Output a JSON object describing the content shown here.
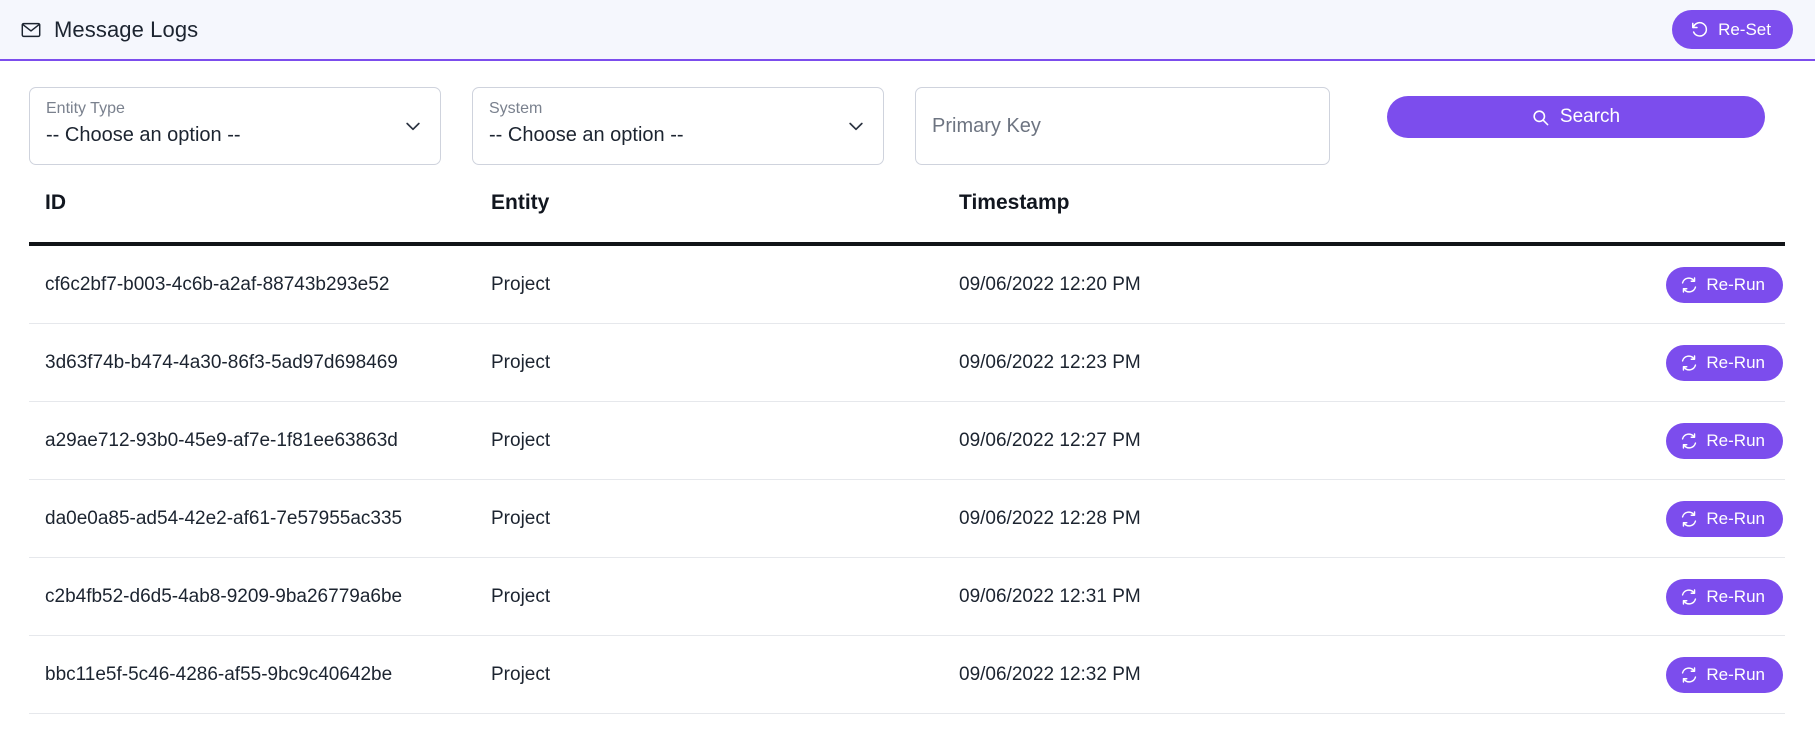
{
  "header": {
    "title": "Message Logs",
    "icon": "envelope-icon",
    "reset_button": {
      "label": "Re-Set",
      "icon": "rotate-ccw-icon"
    }
  },
  "filters": {
    "entity_type": {
      "label": "Entity Type",
      "value": "-- Choose an option --",
      "icon": "chevron-down-icon"
    },
    "system": {
      "label": "System",
      "value": "-- Choose an option --",
      "icon": "chevron-down-icon"
    },
    "primary_key": {
      "placeholder": "Primary Key",
      "value": ""
    },
    "search_button": {
      "label": "Search",
      "icon": "search-icon"
    }
  },
  "table": {
    "columns": [
      "ID",
      "Entity",
      "Timestamp"
    ],
    "row_action_label": "Re-Run",
    "row_action_icon": "refresh-icon",
    "rows": [
      {
        "id": "cf6c2bf7-b003-4c6b-a2af-88743b293e52",
        "entity": "Project",
        "timestamp": "09/06/2022 12:20 PM",
        "action": "Re-Run"
      },
      {
        "id": "3d63f74b-b474-4a30-86f3-5ad97d698469",
        "entity": "Project",
        "timestamp": "09/06/2022 12:23 PM",
        "action": "Re-Run"
      },
      {
        "id": "a29ae712-93b0-45e9-af7e-1f81ee63863d",
        "entity": "Project",
        "timestamp": "09/06/2022 12:27 PM",
        "action": "Re-Run"
      },
      {
        "id": "da0e0a85-ad54-42e2-af61-7e57955ac335",
        "entity": "Project",
        "timestamp": "09/06/2022 12:28 PM",
        "action": "Re-Run"
      },
      {
        "id": "c2b4fb52-d6d5-4ab8-9209-9ba26779a6be",
        "entity": "Project",
        "timestamp": "09/06/2022 12:31 PM",
        "action": "Re-Run"
      },
      {
        "id": "bbc11e5f-5c46-4286-af55-9bc9c40642be",
        "entity": "Project",
        "timestamp": "09/06/2022 12:32 PM",
        "action": "Re-Run"
      }
    ]
  },
  "colors": {
    "accent": "#7c4ded",
    "header_bg": "#f5f7fd",
    "text": "#1c2430",
    "muted": "#7a818e"
  }
}
